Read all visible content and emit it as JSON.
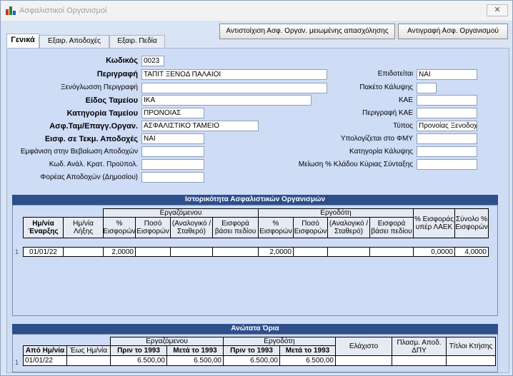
{
  "window": {
    "title": "Ασφαλιστικοί Οργανισμοί",
    "close": "✕"
  },
  "buttons": {
    "map_reduced": "Αντιστοίχιση Ασφ. Οργαν. μειωμένης απασχόλησης",
    "copy_org": "Αντιγραφή Ασφ. Οργανισμού"
  },
  "tabs": [
    "Γενικά",
    "Εξαιρ. Αποδοχές",
    "Εξαιρ. Πεδία"
  ],
  "form": {
    "code": {
      "label": "Κωδικός",
      "value": "0023"
    },
    "description": {
      "label": "Περιγραφή",
      "value": "ΤΑΠΙΤ ΞΕΝΟΔ ΠΑΛΑΙΟΙ"
    },
    "foreign_description": {
      "label": "Ξενόγλωσση Περιγραφή",
      "value": ""
    },
    "fund_type": {
      "label": "Είδος Ταμείου",
      "value": "ΙΚΑ"
    },
    "fund_category": {
      "label": "Κατηγορία Ταμείου",
      "value": "ΠΡΟΝΟΙΑΣ"
    },
    "insurance_org": {
      "label": "Ασφ.Ταμ/Επαγγ.Οργαν.",
      "value": "ΑΣΦΑΛΙΣΤΙΚΟ ΤΑΜΕΙΟ"
    },
    "entry_in_earnings": {
      "label": "Εισφ. σε Τεκμ. Αποδοχές",
      "value": "ΝΑΙ"
    },
    "show_in_certificate": {
      "label": "Εμφάνιση στην Βεβαίωση Αποδοχών",
      "value": ""
    },
    "analysis_code": {
      "label": "Κωδ. Ανάλ. Κρατ. Προϋπολ.",
      "value": ""
    },
    "earnings_body": {
      "label": "Φορέας Αποδοχών (Δημοσίου)",
      "value": ""
    },
    "subsidized": {
      "label": "Επιδοτείται",
      "value": "ΝΑΙ"
    },
    "coverage_package": {
      "label": "Πακέτο Κάλυψης",
      "value": ""
    },
    "kae": {
      "label": "ΚΑΕ",
      "value": ""
    },
    "kae_description": {
      "label": "Περιγραφή ΚΑΕ",
      "value": ""
    },
    "type": {
      "label": "Τύπος",
      "value": "Προνοίας Ξενοδοχ"
    },
    "calc_fmy": {
      "label": "Υπολογίζεται στο ΦΜΥ",
      "value": ""
    },
    "coverage_category": {
      "label": "Κατηγορία Κάλυψης",
      "value": ""
    },
    "branch_reduction": {
      "label": "Μείωση % Κλάδου Κύριας Σύνταξης",
      "value": ""
    }
  },
  "history": {
    "title": "Ιστορικότητα Ασφαλιστικών Οργανισμών",
    "group_employee": "Εργαζόμενου",
    "group_employer": "Εργοδότη",
    "columns": {
      "start": "Ημ/νία Έναρξης",
      "end": "Ημ/νία Λήξης",
      "e_pct": "% Εισφορών",
      "e_amount": "Ποσό Εισφορών",
      "e_prop": "(Αναλογικό / Σταθερό)",
      "e_field": "Εισφορά βάσει πεδίου",
      "r_pct": "% Εισφορών",
      "r_amount": "Ποσό Εισφορών",
      "r_prop": "(Αναλογικό / Σταθερό)",
      "r_field": "Εισφορά βάσει πεδίου",
      "laek": "% Εισφοράς υπέρ ΛΑΕΚ",
      "total": "Σύνολο % Εισφορών"
    },
    "row": {
      "num": "1",
      "start": "01/01/22",
      "end": "",
      "e_pct": "2,0000",
      "e_amount": "",
      "e_prop": "",
      "e_field": "",
      "r_pct": "2,0000",
      "r_amount": "",
      "r_prop": "",
      "r_field": "",
      "laek": "0,0000",
      "total": "4,0000"
    }
  },
  "limits": {
    "title": "Ανώτατα Όρια",
    "group_employee": "Εργαζόμενου",
    "group_employer": "Εργοδότη",
    "columns": {
      "from": "Από Ημ/νία",
      "to": "Έως Ημ/νία",
      "e_before": "Πριν το 1993",
      "e_after": "Μετά το 1993",
      "r_before": "Πριν το 1993",
      "r_after": "Μετά το 1993",
      "min": "Ελάχιστο",
      "mult": "Πλασμ. Αποδ. ΔΠΥ",
      "titles": "Τίτλοι Κτήσης"
    },
    "row": {
      "num": "1",
      "from": "01/01/22",
      "to": "",
      "e_before": "6.500,00",
      "e_after": "6.500,00",
      "r_before": "6.500,00",
      "r_after": "6.500,00",
      "min": "",
      "mult": "",
      "titles": ""
    }
  }
}
